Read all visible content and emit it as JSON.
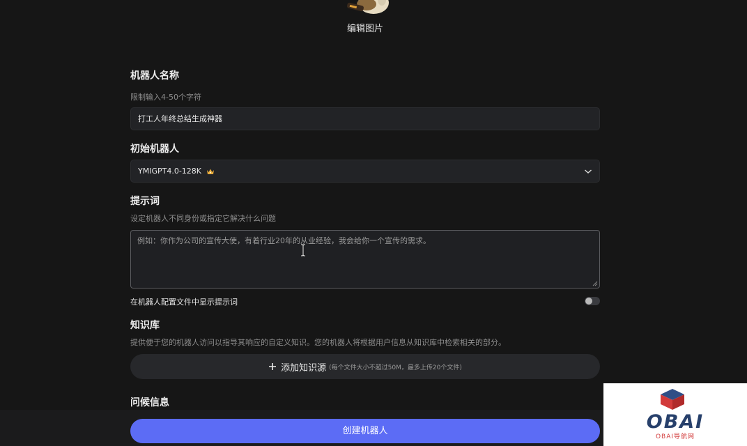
{
  "header": {
    "edit_image_label": "编辑图片"
  },
  "name_section": {
    "label": "机器人名称",
    "hint": "限制输入4-50个字符",
    "value": "打工人年终总结生成神器"
  },
  "model_section": {
    "label": "初始机器人",
    "selected": "YMIGPT4.0-128K",
    "badge_icon": "crown-icon"
  },
  "prompt_section": {
    "label": "提示词",
    "hint": "设定机器人不同身份或指定它解决什么问题",
    "placeholder": "例如：你作为公司的宣传大使，有着行业20年的从业经验，我会给你一个宣传的需求。",
    "show_in_config_label": "在机器人配置文件中显示提示词",
    "show_in_config_enabled": false
  },
  "knowledge_section": {
    "label": "知识库",
    "hint": "提供便于您的机器人访问以指导其响应的自定义知识。您的机器人将根据用户信息从知识库中检索相关的部分。",
    "add_button_label": "添加知识源",
    "add_button_note": "(每个文件大小不超过50M，最多上传20个文件)"
  },
  "greeting_section": {
    "label": "问候信息"
  },
  "actions": {
    "create_label": "创建机器人"
  },
  "watermark": {
    "logo_text": "OBAI",
    "sub_text": "OBAI导航网"
  },
  "colors": {
    "background": "#161616",
    "accent": "#5c6cf5",
    "input_bg": "#222326"
  }
}
